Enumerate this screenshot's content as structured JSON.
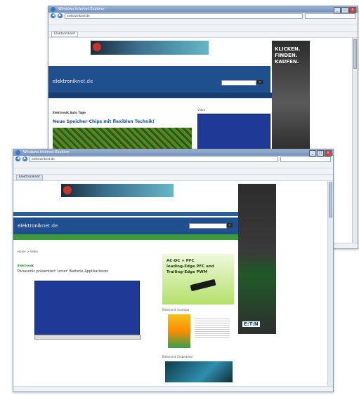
{
  "back_window": {
    "title": "Windows Internet Explorer",
    "url": "elektroniknet.de",
    "tab_label": "Elektroniknet",
    "site_logo_main": "elektronik",
    "site_logo_tld": "net.de",
    "article_kicker": "Elektronik Auto Tage",
    "headline": "Neue Speicher-Chips mit flexiblen Technik!",
    "skyscraper_lines": [
      "KLICKEN.",
      "FINDEN.",
      "KAUFEN."
    ]
  },
  "front_window": {
    "title": "Windows Internet Explorer",
    "url": "elektroniknet.de",
    "tab_label": "Elektroniknet",
    "site_logo_main": "elektronik",
    "site_logo_tld": "net.de",
    "breadcrumb": "Home > Video",
    "article_kicker": "Elektronik",
    "headline": "Panasonic präsentiert 'unter' Batterie Applikationen",
    "product_ad_lines": [
      "AC-DC + PFC",
      "leading-Edge PFC and",
      "Trailing-Edge PWM"
    ],
    "sidebar_label_1": "Elektronik Lesetipp",
    "sidebar_label_2": "Elektronik Embedded",
    "brand": "E:T:N"
  }
}
